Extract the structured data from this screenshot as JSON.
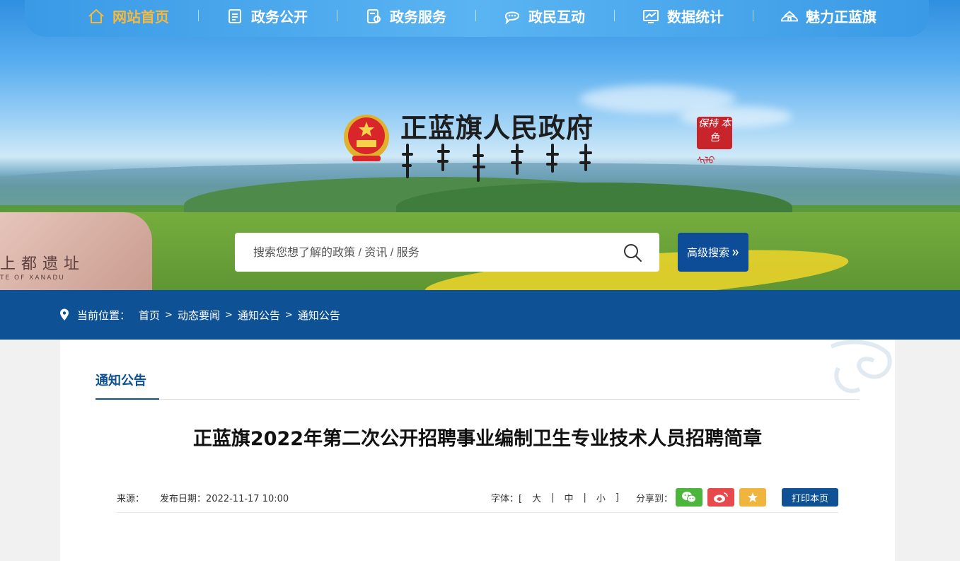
{
  "nav": {
    "items": [
      {
        "label": "网站首页",
        "icon": "home-icon",
        "active": true
      },
      {
        "label": "政务公开",
        "icon": "document-icon"
      },
      {
        "label": "政务服务",
        "icon": "service-icon"
      },
      {
        "label": "政民互动",
        "icon": "chat-icon"
      },
      {
        "label": "数据统计",
        "icon": "chart-icon"
      },
      {
        "label": "魅力正蓝旗",
        "icon": "yurt-icon"
      }
    ]
  },
  "header": {
    "site_title": "正蓝旗人民政府",
    "mongolian_title": "ᠰᠢᠯᠤ ᠬᠥᠬᠡ ᠬᠣᠰᠢᠭᠤᠨ ᠤ ᠠᠷᠠᠳ ᠤᠨ ᠵᠠᠰᠠᠭ ᠤᠨ ᠭᠠᠵᠠᠷ",
    "seal_text": "保持 本色",
    "seal_sub": "ᠰᠢᠯᠤ",
    "rock_text": "上都遗址",
    "rock_sub": "TE OF XANADU"
  },
  "search": {
    "placeholder": "搜索您想了解的政策 / 资讯 / 服务",
    "advanced_label": "高级搜索"
  },
  "breadcrumb": {
    "prefix": "当前位置：",
    "items": [
      "首页",
      "动态要闻",
      "通知公告",
      "通知公告"
    ]
  },
  "section": {
    "tab": "通知公告"
  },
  "article": {
    "title": "正蓝旗2022年第二次公开招聘事业编制卫生专业技术人员招聘简章",
    "source_label": "来源：",
    "date_label": "发布日期：",
    "date": "2022-11-17 10:00",
    "font_label": "字体：",
    "font_options": [
      "大",
      "中",
      "小"
    ],
    "share_label": "分享到：",
    "print_label": "打印本页"
  },
  "colors": {
    "primary": "#0f5195",
    "nav_active": "#f6b93b",
    "wechat": "#4cb63c",
    "weibo": "#e8494c",
    "favorite": "#f0b53c"
  }
}
